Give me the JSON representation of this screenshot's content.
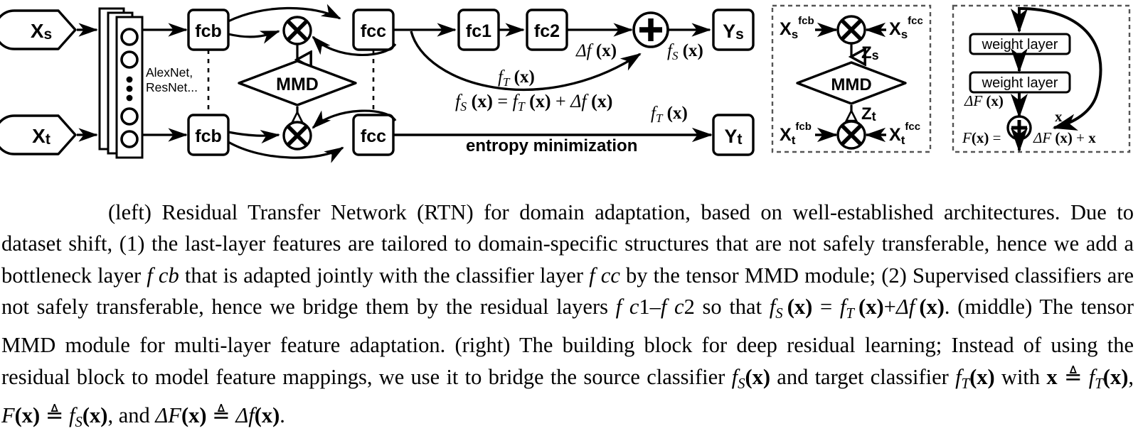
{
  "figure": {
    "type": "architecture-diagram",
    "panels": [
      "left",
      "middle",
      "right"
    ]
  },
  "left_panel": {
    "name": "Residual Transfer Network",
    "inputs": [
      {
        "id": "xs",
        "label_main": "X",
        "label_sub": "s"
      },
      {
        "id": "xt",
        "label_main": "X",
        "label_sub": "t"
      }
    ],
    "backbone_label_line1": "AlexNet,",
    "backbone_label_line2": "ResNet...",
    "blocks": {
      "fcb_source": "fcb",
      "fcb_target": "fcb",
      "fcc_source": "fcc",
      "fcc_target": "fcc",
      "fc1": "fc1",
      "fc2": "fc2",
      "mmd": "MMD"
    },
    "outputs": [
      {
        "id": "ys",
        "label_main": "Y",
        "label_sub": "s"
      },
      {
        "id": "yt",
        "label_main": "Y",
        "label_sub": "t"
      }
    ],
    "annotations": {
      "delta_f": "Δf (x)",
      "f_T": "f_T (x)",
      "f_S": "f_S (x)",
      "equation": "f_S (x) = f_T (x) + Δf (x)",
      "entropy": "entropy minimization",
      "f_T_target": "f_T (x)"
    },
    "operators": {
      "tensor_product": "⊗",
      "sum": "⊕"
    }
  },
  "middle_panel": {
    "title": "tensor MMD module",
    "nodes": {
      "xs_fcb": {
        "base": "X",
        "sub": "s",
        "sup": "fcb"
      },
      "xs_fcc": {
        "base": "X",
        "sub": "s",
        "sup": "fcc"
      },
      "xt_fcb": {
        "base": "X",
        "sub": "t",
        "sup": "fcb"
      },
      "xt_fcc": {
        "base": "X",
        "sub": "t",
        "sup": "fcc"
      },
      "z_s": {
        "base": "Z",
        "sub": "s"
      },
      "z_t": {
        "base": "Z",
        "sub": "t"
      },
      "mmd": "MMD"
    },
    "operators": {
      "tensor_product": "⊗"
    }
  },
  "right_panel": {
    "title": "deep residual building block",
    "layers": [
      "weight layer",
      "weight layer"
    ],
    "labels": {
      "delta_F": "ΔF (x)",
      "identity": "x",
      "output_lhs": "F(x) =",
      "output_rhs": "ΔF (x) + x"
    },
    "operators": {
      "sum": "⊕"
    }
  },
  "caption": {
    "lines": [
      "(left) Residual Transfer Network (RTN) for domain adaptation, based on well-established",
      "architectures. Due to dataset shift, (1) the last-layer features are tailored to domain-specific structures",
      "that are not safely transferable, hence we add a bottleneck layer fcb that is adapted jointly with the",
      "classifier layer fcc by the tensor MMD module; (2) Supervised classifiers are not safely transferable,",
      "hence we bridge them by the residual layers fc1–fc2 so that fS (x) = fT (x)+Δf (x). (middle) The",
      "tensor MMD module for multi-layer feature adaptation. (right) The building block for deep residual",
      "learning; Instead of using the residual block to model feature mappings, we use it to bridge the source",
      "classifier fS(x) and target classifier fT(x) with x ≜ fT(x), F(x) ≜ fS(x), and ΔF(x) ≜ Δf(x)."
    ],
    "full_text": "(left) Residual Transfer Network (RTN) for domain adaptation, based on well-established architectures. Due to dataset shift, (1) the last-layer features are tailored to domain-specific structures that are not safely transferable, hence we add a bottleneck layer fcb that is adapted jointly with the classifier layer fcc by the tensor MMD module; (2) Supervised classifiers are not safely transferable, hence we bridge them by the residual layers fc1–fc2 so that fS (x) = fT (x)+Δf (x). (middle) The tensor MMD module for multi-layer feature adaptation. (right) The building block for deep residual learning; Instead of using the residual block to model feature mappings, we use it to bridge the source classifier fS(x) and target classifier fT(x) with x ≜ fT(x), F(x) ≜ fS(x), and ΔF(x) ≜ Δf(x)."
  },
  "colors": {
    "stroke": "#000000",
    "background": "#ffffff",
    "text": "#000000"
  }
}
